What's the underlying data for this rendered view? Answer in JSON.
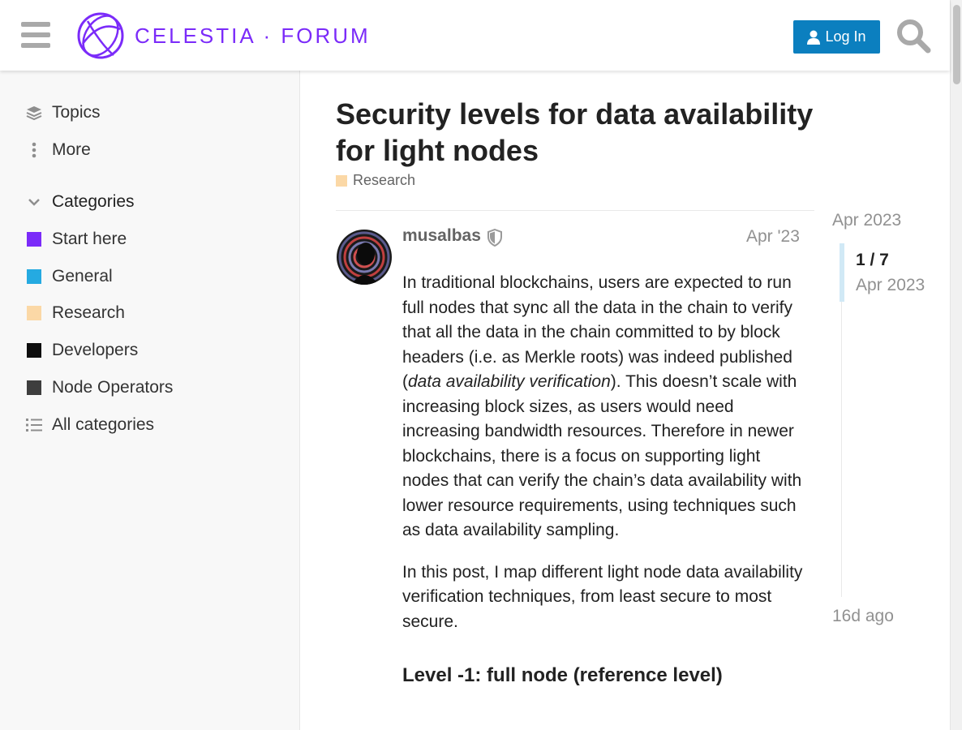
{
  "header": {
    "logo_text": "CELESTIA · FORUM",
    "login_label": "Log In"
  },
  "sidebar": {
    "nav": [
      {
        "label": "Topics",
        "icon": "layers-icon"
      },
      {
        "label": "More",
        "icon": "vertical-ellipsis-icon"
      }
    ],
    "categories_heading": "Categories",
    "categories": [
      {
        "label": "Start here",
        "color": "#7b2bf9"
      },
      {
        "label": "General",
        "color": "#25aae1"
      },
      {
        "label": "Research",
        "color": "#fbd8a6"
      },
      {
        "label": "Developers",
        "color": "#0e0e0e"
      },
      {
        "label": "Node Operators",
        "color": "#3e3e3e"
      }
    ],
    "all_categories": "All categories"
  },
  "topic": {
    "title": "Security levels for data availability for light nodes",
    "category": "Research",
    "category_color": "#fbd8a6"
  },
  "post": {
    "username": "musalbas",
    "date": "Apr '23",
    "paragraph1_a": "In traditional blockchains, users are expected to run full nodes that sync all the data in the chain to verify that all the data in the chain committed to by block headers (i.e. as Merkle roots) was indeed published (",
    "paragraph1_em": "data availability verification",
    "paragraph1_b": "). This doesn’t scale with increasing block sizes, as users would need increasing bandwidth resources. Therefore in newer blockchains, there is a focus on supporting light nodes that can verify the chain’s data availability with lower resource requirements, using techniques such as data availability sampling.",
    "paragraph2": "In this post, I map different light node data availability verification techniques, from least secure to most secure.",
    "heading": "Level -1: full node (reference level)"
  },
  "timeline": {
    "start": "Apr 2023",
    "count": "1 / 7",
    "current_date": "Apr 2023",
    "end": "16d ago"
  },
  "colors": {
    "brand": "#7b2bf9",
    "login_button": "#0b7fbf"
  }
}
